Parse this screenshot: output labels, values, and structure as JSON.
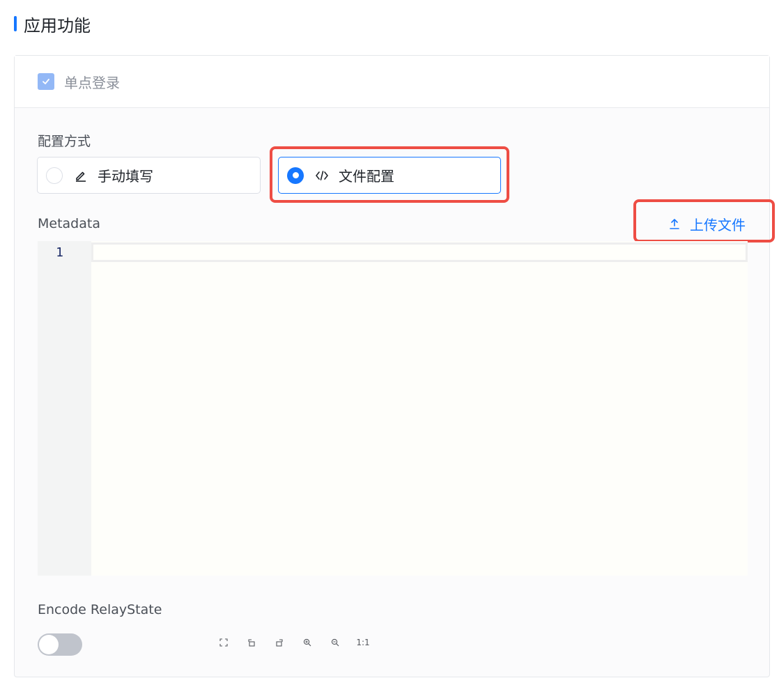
{
  "section": {
    "title": "应用功能"
  },
  "sso": {
    "label": "单点登录",
    "checked": true
  },
  "config": {
    "label": "配置方式",
    "options": [
      {
        "label": "手动填写",
        "icon": "pencil-icon",
        "selected": false
      },
      {
        "label": "文件配置",
        "icon": "code-icon",
        "selected": true
      }
    ]
  },
  "metadata": {
    "label": "Metadata",
    "upload_label": "上传文件",
    "line_numbers": [
      "1"
    ]
  },
  "relay": {
    "label": "Encode RelayState",
    "enabled": false
  },
  "toolbar": {
    "reset_label": "1:1"
  },
  "colors": {
    "accent": "#1677ff",
    "highlight": "#ee4d44"
  }
}
